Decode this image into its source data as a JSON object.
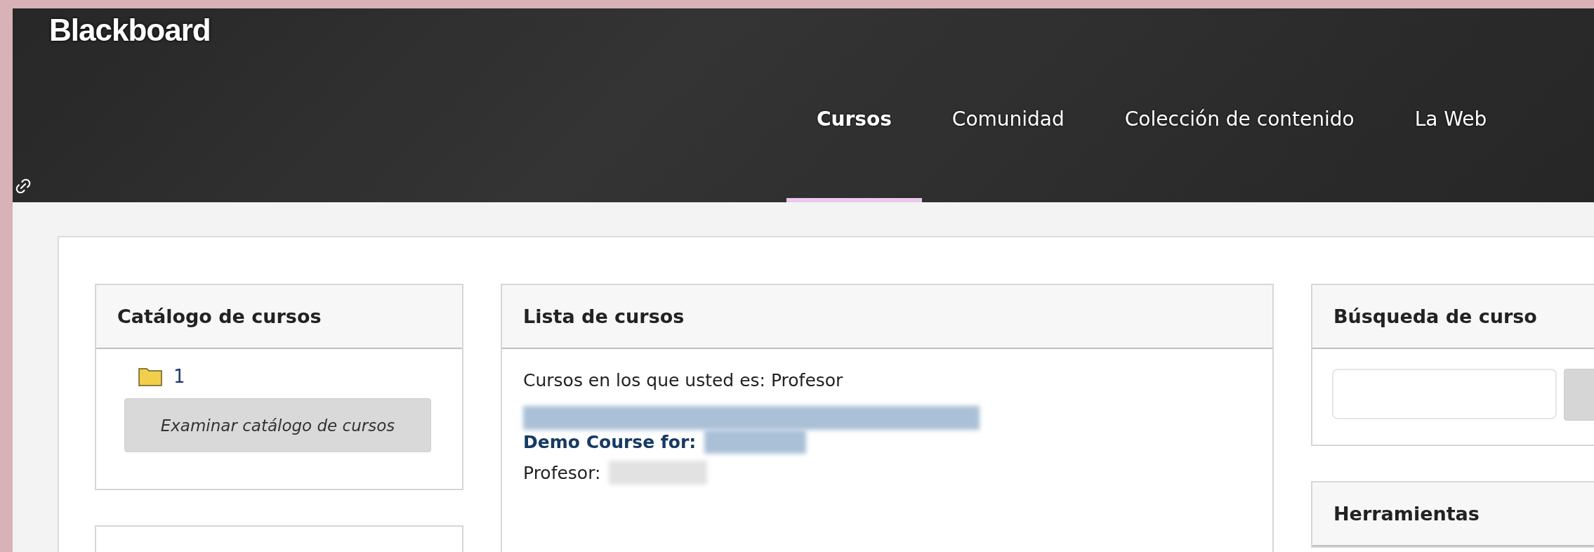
{
  "header": {
    "logo": "Blackboard"
  },
  "tabs": [
    {
      "label": "Cursos",
      "selected": true
    },
    {
      "label": "Comunidad",
      "selected": false
    },
    {
      "label": "Colección de contenido",
      "selected": false
    },
    {
      "label": "La Web",
      "selected": false
    }
  ],
  "catalog": {
    "title": "Catálogo de cursos",
    "folder": "1",
    "button": "Examinar catálogo de cursos"
  },
  "course_list": {
    "title": "Lista de cursos",
    "intro": "Cursos en los que usted es: Profesor",
    "course_prefix": "Demo Course for:",
    "instructor_label": "Profesor:"
  },
  "course_search": {
    "title": "Búsqueda de curso"
  },
  "tools": {
    "title": "Herramientas"
  }
}
